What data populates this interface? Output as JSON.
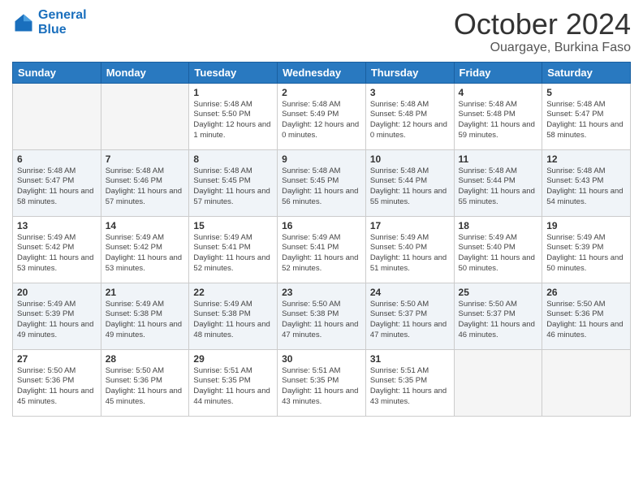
{
  "header": {
    "logo_line1": "General",
    "logo_line2": "Blue",
    "title": "October 2024",
    "subtitle": "Ouargaye, Burkina Faso"
  },
  "weekdays": [
    "Sunday",
    "Monday",
    "Tuesday",
    "Wednesday",
    "Thursday",
    "Friday",
    "Saturday"
  ],
  "weeks": [
    [
      {
        "day": "",
        "sunrise": "",
        "sunset": "",
        "daylight": ""
      },
      {
        "day": "",
        "sunrise": "",
        "sunset": "",
        "daylight": ""
      },
      {
        "day": "1",
        "sunrise": "Sunrise: 5:48 AM",
        "sunset": "Sunset: 5:50 PM",
        "daylight": "Daylight: 12 hours and 1 minute."
      },
      {
        "day": "2",
        "sunrise": "Sunrise: 5:48 AM",
        "sunset": "Sunset: 5:49 PM",
        "daylight": "Daylight: 12 hours and 0 minutes."
      },
      {
        "day": "3",
        "sunrise": "Sunrise: 5:48 AM",
        "sunset": "Sunset: 5:48 PM",
        "daylight": "Daylight: 12 hours and 0 minutes."
      },
      {
        "day": "4",
        "sunrise": "Sunrise: 5:48 AM",
        "sunset": "Sunset: 5:48 PM",
        "daylight": "Daylight: 11 hours and 59 minutes."
      },
      {
        "day": "5",
        "sunrise": "Sunrise: 5:48 AM",
        "sunset": "Sunset: 5:47 PM",
        "daylight": "Daylight: 11 hours and 58 minutes."
      }
    ],
    [
      {
        "day": "6",
        "sunrise": "Sunrise: 5:48 AM",
        "sunset": "Sunset: 5:47 PM",
        "daylight": "Daylight: 11 hours and 58 minutes."
      },
      {
        "day": "7",
        "sunrise": "Sunrise: 5:48 AM",
        "sunset": "Sunset: 5:46 PM",
        "daylight": "Daylight: 11 hours and 57 minutes."
      },
      {
        "day": "8",
        "sunrise": "Sunrise: 5:48 AM",
        "sunset": "Sunset: 5:45 PM",
        "daylight": "Daylight: 11 hours and 57 minutes."
      },
      {
        "day": "9",
        "sunrise": "Sunrise: 5:48 AM",
        "sunset": "Sunset: 5:45 PM",
        "daylight": "Daylight: 11 hours and 56 minutes."
      },
      {
        "day": "10",
        "sunrise": "Sunrise: 5:48 AM",
        "sunset": "Sunset: 5:44 PM",
        "daylight": "Daylight: 11 hours and 55 minutes."
      },
      {
        "day": "11",
        "sunrise": "Sunrise: 5:48 AM",
        "sunset": "Sunset: 5:44 PM",
        "daylight": "Daylight: 11 hours and 55 minutes."
      },
      {
        "day": "12",
        "sunrise": "Sunrise: 5:48 AM",
        "sunset": "Sunset: 5:43 PM",
        "daylight": "Daylight: 11 hours and 54 minutes."
      }
    ],
    [
      {
        "day": "13",
        "sunrise": "Sunrise: 5:49 AM",
        "sunset": "Sunset: 5:42 PM",
        "daylight": "Daylight: 11 hours and 53 minutes."
      },
      {
        "day": "14",
        "sunrise": "Sunrise: 5:49 AM",
        "sunset": "Sunset: 5:42 PM",
        "daylight": "Daylight: 11 hours and 53 minutes."
      },
      {
        "day": "15",
        "sunrise": "Sunrise: 5:49 AM",
        "sunset": "Sunset: 5:41 PM",
        "daylight": "Daylight: 11 hours and 52 minutes."
      },
      {
        "day": "16",
        "sunrise": "Sunrise: 5:49 AM",
        "sunset": "Sunset: 5:41 PM",
        "daylight": "Daylight: 11 hours and 52 minutes."
      },
      {
        "day": "17",
        "sunrise": "Sunrise: 5:49 AM",
        "sunset": "Sunset: 5:40 PM",
        "daylight": "Daylight: 11 hours and 51 minutes."
      },
      {
        "day": "18",
        "sunrise": "Sunrise: 5:49 AM",
        "sunset": "Sunset: 5:40 PM",
        "daylight": "Daylight: 11 hours and 50 minutes."
      },
      {
        "day": "19",
        "sunrise": "Sunrise: 5:49 AM",
        "sunset": "Sunset: 5:39 PM",
        "daylight": "Daylight: 11 hours and 50 minutes."
      }
    ],
    [
      {
        "day": "20",
        "sunrise": "Sunrise: 5:49 AM",
        "sunset": "Sunset: 5:39 PM",
        "daylight": "Daylight: 11 hours and 49 minutes."
      },
      {
        "day": "21",
        "sunrise": "Sunrise: 5:49 AM",
        "sunset": "Sunset: 5:38 PM",
        "daylight": "Daylight: 11 hours and 49 minutes."
      },
      {
        "day": "22",
        "sunrise": "Sunrise: 5:49 AM",
        "sunset": "Sunset: 5:38 PM",
        "daylight": "Daylight: 11 hours and 48 minutes."
      },
      {
        "day": "23",
        "sunrise": "Sunrise: 5:50 AM",
        "sunset": "Sunset: 5:38 PM",
        "daylight": "Daylight: 11 hours and 47 minutes."
      },
      {
        "day": "24",
        "sunrise": "Sunrise: 5:50 AM",
        "sunset": "Sunset: 5:37 PM",
        "daylight": "Daylight: 11 hours and 47 minutes."
      },
      {
        "day": "25",
        "sunrise": "Sunrise: 5:50 AM",
        "sunset": "Sunset: 5:37 PM",
        "daylight": "Daylight: 11 hours and 46 minutes."
      },
      {
        "day": "26",
        "sunrise": "Sunrise: 5:50 AM",
        "sunset": "Sunset: 5:36 PM",
        "daylight": "Daylight: 11 hours and 46 minutes."
      }
    ],
    [
      {
        "day": "27",
        "sunrise": "Sunrise: 5:50 AM",
        "sunset": "Sunset: 5:36 PM",
        "daylight": "Daylight: 11 hours and 45 minutes."
      },
      {
        "day": "28",
        "sunrise": "Sunrise: 5:50 AM",
        "sunset": "Sunset: 5:36 PM",
        "daylight": "Daylight: 11 hours and 45 minutes."
      },
      {
        "day": "29",
        "sunrise": "Sunrise: 5:51 AM",
        "sunset": "Sunset: 5:35 PM",
        "daylight": "Daylight: 11 hours and 44 minutes."
      },
      {
        "day": "30",
        "sunrise": "Sunrise: 5:51 AM",
        "sunset": "Sunset: 5:35 PM",
        "daylight": "Daylight: 11 hours and 43 minutes."
      },
      {
        "day": "31",
        "sunrise": "Sunrise: 5:51 AM",
        "sunset": "Sunset: 5:35 PM",
        "daylight": "Daylight: 11 hours and 43 minutes."
      },
      {
        "day": "",
        "sunrise": "",
        "sunset": "",
        "daylight": ""
      },
      {
        "day": "",
        "sunrise": "",
        "sunset": "",
        "daylight": ""
      }
    ]
  ]
}
